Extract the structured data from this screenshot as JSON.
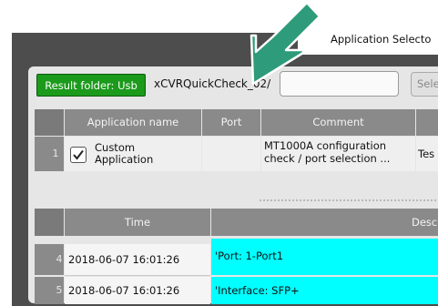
{
  "tab": {
    "label": "Application Selecto"
  },
  "toolbar": {
    "result_folder_label": "Result folder: Usb",
    "path_value": "xCVRQuickCheck_02/",
    "select_label": "Sele"
  },
  "apps_table": {
    "headers": {
      "name": "Application name",
      "port": "Port",
      "comment": "Comment"
    },
    "rows": [
      {
        "index": "1",
        "checked": true,
        "name_line1": "Custom",
        "name_line2": "Application",
        "comment_line1": "MT1000A configuration",
        "comment_line2": "check / port selection ...",
        "extra": "Tes"
      }
    ]
  },
  "log_table": {
    "headers": {
      "time": "Time",
      "description": "Desc"
    },
    "rows": [
      {
        "index": "4",
        "time": "2018-06-07 16:01:26",
        "description": "'Port: 1-Port1"
      },
      {
        "index": "5",
        "time": "2018-06-07 16:01:26",
        "description": "'Interface: SFP+"
      }
    ]
  },
  "colors": {
    "result_button": "#1b9a1b",
    "highlight": "#00ffff",
    "arrow": "#2e9b7a"
  }
}
